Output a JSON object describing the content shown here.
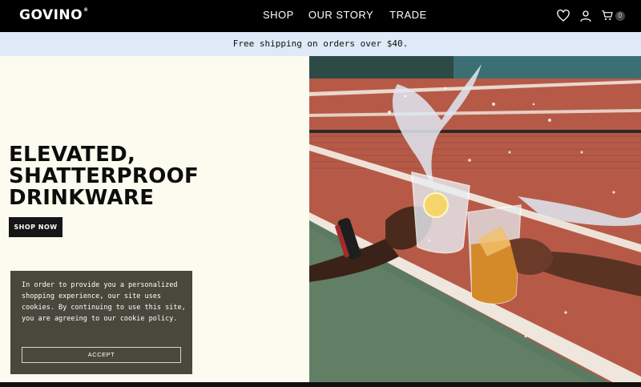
{
  "header": {
    "logo": "GOVINO",
    "logo_mark": "®",
    "nav": [
      "SHOP",
      "OUR STORY",
      "TRADE"
    ],
    "icons": [
      "heart-icon",
      "user-icon",
      "cart-icon"
    ],
    "cart_count": "0"
  },
  "promo": {
    "text": "Free shipping on orders over $40."
  },
  "hero": {
    "headline": [
      "ELEVATED,",
      "SHATTERPROOF",
      "DRINKWARE"
    ],
    "cta": "SHOP NOW",
    "image_alt": "two glasses toasting over tennis court"
  },
  "cookie": {
    "text": "In order to provide you a personalized shopping experience, our site uses cookies. By continuing to use this site, you are agreeing to our cookie policy.",
    "button": "ACCEPT"
  },
  "colors": {
    "header_bg": "#000000",
    "promo_bg": "#dfe9f7",
    "hero_bg": "#fbfbef",
    "cookie_bg": "#4a473d",
    "button_bg": "#161616"
  }
}
